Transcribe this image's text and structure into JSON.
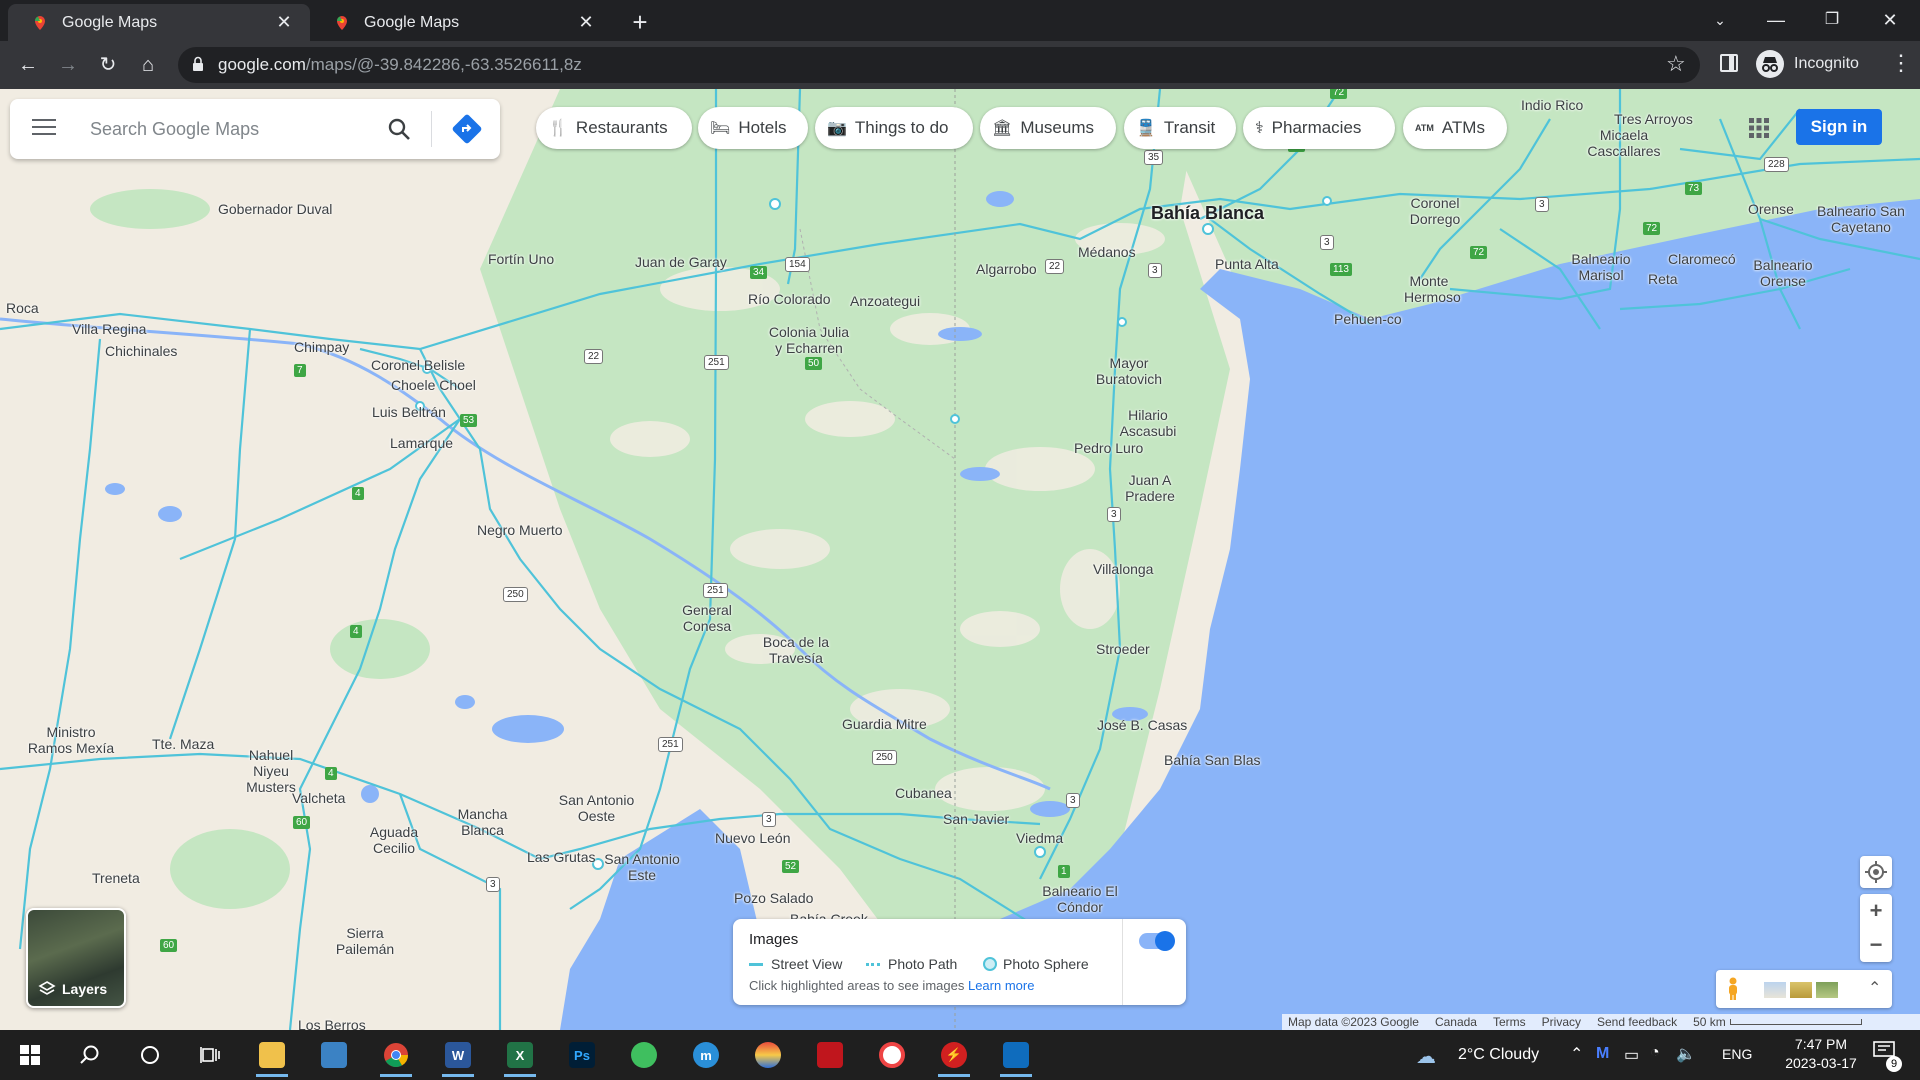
{
  "browser": {
    "tabs": [
      {
        "title": "Google Maps",
        "active": true
      },
      {
        "title": "Google Maps",
        "active": false
      }
    ],
    "url_host": "google.com",
    "url_path": "/maps/@-39.842286,-63.3526611,8z",
    "profile": "Incognito"
  },
  "search": {
    "placeholder": "Search Google Maps"
  },
  "chips": [
    {
      "label": "Restaurants",
      "icon": "fork-knife-icon"
    },
    {
      "label": "Hotels",
      "icon": "bed-icon"
    },
    {
      "label": "Things to do",
      "icon": "camera-icon"
    },
    {
      "label": "Museums",
      "icon": "museum-icon"
    },
    {
      "label": "Transit",
      "icon": "train-icon"
    },
    {
      "label": "Pharmacies",
      "icon": "pharmacy-icon"
    },
    {
      "label": "ATMs",
      "icon": "atm-icon"
    }
  ],
  "sign_in": "Sign in",
  "layers_label": "Layers",
  "images_panel": {
    "title": "Images",
    "legend": [
      "Street View",
      "Photo Path",
      "Photo Sphere"
    ],
    "hint": "Click highlighted areas to see images",
    "link": "Learn more",
    "toggle_on": true
  },
  "map_footer": {
    "data": "Map data ©2023 Google",
    "country": "Canada",
    "terms": "Terms",
    "privacy": "Privacy",
    "feedback": "Send feedback",
    "scale": "50 km"
  },
  "places": [
    {
      "name": "Bahía Blanca",
      "big": true
    },
    {
      "name": "Gobernador Duval"
    },
    {
      "name": "Fortín Uno"
    },
    {
      "name": "Juan de Garay"
    },
    {
      "name": "Río Colorado"
    },
    {
      "name": "Anzoategui"
    },
    {
      "name": "Algarrobo"
    },
    {
      "name": "Médanos"
    },
    {
      "name": "Punta Alta"
    },
    {
      "name": "Indio Rico"
    },
    {
      "name": "Tres Arroyos"
    },
    {
      "name": "Micaela Cascallares"
    },
    {
      "name": "Coronel Dorrego"
    },
    {
      "name": "Orense"
    },
    {
      "name": "Balneario San Cayetano"
    },
    {
      "name": "Balneario Marisol"
    },
    {
      "name": "Claromecó"
    },
    {
      "name": "Reta"
    },
    {
      "name": "Balneario Orense"
    },
    {
      "name": "Monte Hermoso"
    },
    {
      "name": "Pehuen-co"
    },
    {
      "name": "Colonia Julia y Echarren"
    },
    {
      "name": "Villa Regina"
    },
    {
      "name": "Chichinales"
    },
    {
      "name": "Chimpay"
    },
    {
      "name": "Coronel Belisle"
    },
    {
      "name": "Choele Choel"
    },
    {
      "name": "Luis Beltrán"
    },
    {
      "name": "Lamarque"
    },
    {
      "name": "Mayor Buratovich"
    },
    {
      "name": "Hilario Ascasubi"
    },
    {
      "name": "Pedro Luro"
    },
    {
      "name": "Juan A Pradere"
    },
    {
      "name": "Negro Muerto"
    },
    {
      "name": "Villalonga"
    },
    {
      "name": "General Conesa"
    },
    {
      "name": "Boca de la Travesía"
    },
    {
      "name": "Stroeder"
    },
    {
      "name": "Guardia Mitre"
    },
    {
      "name": "José B. Casas"
    },
    {
      "name": "Bahía San Blas"
    },
    {
      "name": "Ministro Ramos Mexía"
    },
    {
      "name": "Tte. Maza"
    },
    {
      "name": "Nahuel Niyeu Musters"
    },
    {
      "name": "Valcheta"
    },
    {
      "name": "Mancha Blanca"
    },
    {
      "name": "San Antonio Oeste"
    },
    {
      "name": "Cubanea"
    },
    {
      "name": "San Javier"
    },
    {
      "name": "Viedma"
    },
    {
      "name": "Nuevo León"
    },
    {
      "name": "Aguada Cecilio"
    },
    {
      "name": "Las Grutas"
    },
    {
      "name": "San Antonio Este"
    },
    {
      "name": "Treneta"
    },
    {
      "name": "Pozo Salado"
    },
    {
      "name": "Balneario El Cóndor"
    },
    {
      "name": "Sierra Pailemán"
    },
    {
      "name": "Los Berros"
    },
    {
      "name": "Bahía Creek"
    },
    {
      "name": "Roca"
    }
  ],
  "routes": [
    "22",
    "251",
    "154",
    "34",
    "3",
    "250",
    "4",
    "53",
    "50",
    "7",
    "35",
    "51",
    "72",
    "228",
    "73",
    "113",
    "52",
    "1",
    "60"
  ],
  "taskbar": {
    "weather": "2°C  Cloudy",
    "lang": "ENG",
    "time": "7:47 PM",
    "date": "2023-03-17",
    "notifications": "9"
  },
  "colors": {
    "water": "#8ab4f8",
    "land": "#f1ece2",
    "green": "#bfe3c3",
    "road": "#4fc3d9",
    "accent": "#1a73e8"
  }
}
